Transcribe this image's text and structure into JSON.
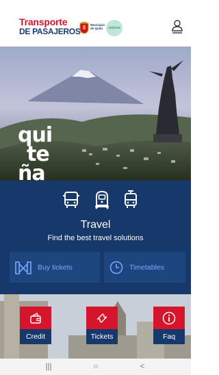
{
  "header": {
    "logo_line1": "Transporte",
    "logo_line2": "DE PASAJEROS",
    "municipality_line1": "Municipio",
    "municipality_line2": "de Quito",
    "partner_logo": "solzone",
    "user_icon": "user-icon"
  },
  "hero": {
    "word_line1": "qui",
    "word_line2": "te",
    "word_line3": "ña"
  },
  "travel": {
    "mode_icons": [
      "bus-icon",
      "metro-icon",
      "trolleybus-icon"
    ],
    "title": "Travel",
    "subtitle": "Find the best travel solutions",
    "buy_tickets": "Buy tickets",
    "timetables": "Timetables"
  },
  "quick_actions": [
    {
      "label": "Credit",
      "icon": "wallet-icon"
    },
    {
      "label": "Tickets",
      "icon": "ticket-icon"
    },
    {
      "label": "Faq",
      "icon": "info-icon"
    }
  ],
  "navbar": {
    "recents": "|||",
    "home": "○",
    "back": "<"
  },
  "colors": {
    "brand_red": "#d5122a",
    "brand_blue": "#17386b",
    "button_blue": "#1d467e",
    "link_blue": "#7aa7ff"
  }
}
